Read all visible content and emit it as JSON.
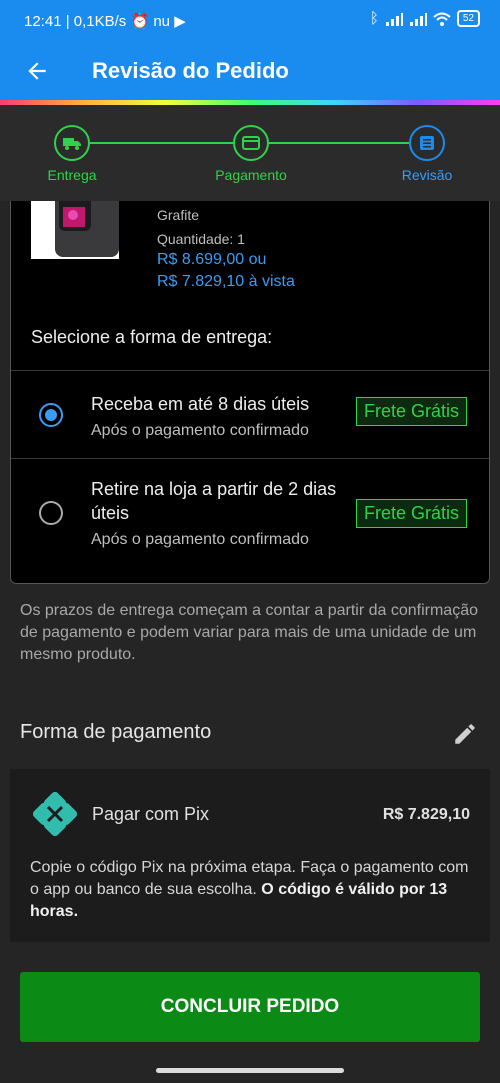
{
  "status_bar": {
    "time": "12:41",
    "network_info": "| 0,1KB/s",
    "extra_glyph": "nu",
    "battery": "52"
  },
  "header": {
    "title": "Revisão do Pedido"
  },
  "stepper": {
    "steps": [
      {
        "label": "Entrega",
        "state": "done",
        "icon": "truck-icon"
      },
      {
        "label": "Pagamento",
        "state": "done",
        "icon": "card-icon"
      },
      {
        "label": "Revisão",
        "state": "active",
        "icon": "list-icon"
      }
    ]
  },
  "product": {
    "color": "Grafite",
    "quantity": "Quantidade:  1",
    "price_installments": "R$ 8.699,00 ou",
    "price_cash": "R$ 7.829,10 à vista"
  },
  "delivery": {
    "heading": "Selecione a forma de entrega:",
    "options": [
      {
        "title": "Receba em até 8 dias úteis",
        "subtitle": "Após o pagamento confirmado",
        "badge": "Frete Grátis",
        "selected": true
      },
      {
        "title": "Retire na loja a partir de 2 dias úteis",
        "subtitle": "Após o pagamento confirmado",
        "badge": "Frete Grátis",
        "selected": false
      }
    ]
  },
  "note": "Os prazos de entrega começam a contar a partir da confirmação de pagamento e podem variar para mais de uma unidade de um mesmo produto.",
  "payment": {
    "heading": "Forma de pagamento",
    "method": "Pagar com Pix",
    "amount": "R$ 7.829,10",
    "description": "Copie o código Pix na próxima etapa. Faça o pagamento com o app ou banco de sua escolha.",
    "description_bold": "O código é válido por 13 horas."
  },
  "cta": {
    "label": "CONCLUIR PEDIDO"
  },
  "colors": {
    "primary": "#1a8cf0",
    "success": "#2fd34a",
    "cta": "#0c8a16",
    "link": "#3a9cf5"
  }
}
